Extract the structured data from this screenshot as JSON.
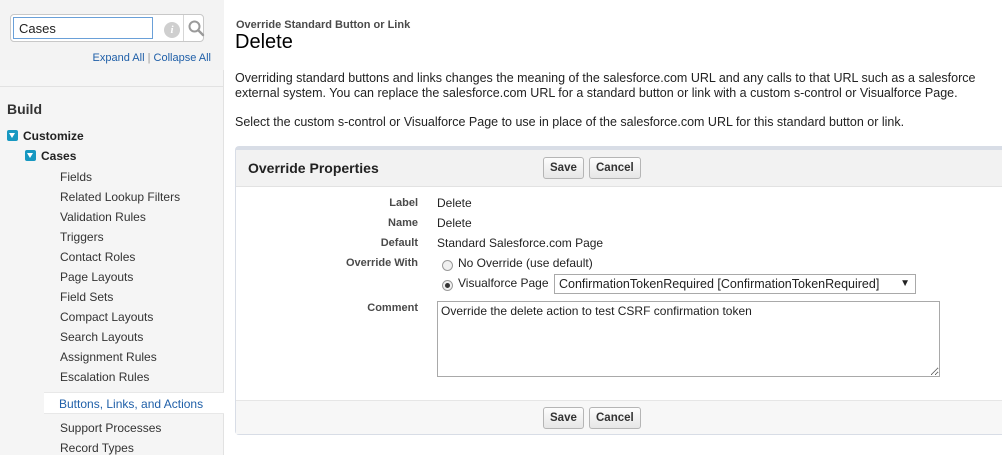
{
  "sidebar": {
    "search": {
      "value": "Cases",
      "info_icon": "info-icon",
      "search_icon": "magnifier-icon"
    },
    "expand_all": "Expand All",
    "separator": "|",
    "collapse_all": "Collapse All",
    "build_heading": "Build",
    "tree": {
      "customize": "Customize",
      "cases": "Cases",
      "items": [
        "Fields",
        "Related Lookup Filters",
        "Validation Rules",
        "Triggers",
        "Contact Roles",
        "Page Layouts",
        "Field Sets",
        "Compact Layouts",
        "Search Layouts",
        "Assignment Rules",
        "Escalation Rules"
      ],
      "active_item": "Buttons, Links, and Actions",
      "after_items": [
        "Support Processes",
        "Record Types"
      ]
    }
  },
  "main": {
    "breadcrumb": "Override Standard Button or Link",
    "title": "Delete",
    "description_line1": "Overriding standard buttons and links changes the meaning of the salesforce.com URL and any calls to that URL such as a salesforce",
    "description_line2": "external system. You can replace the salesforce.com URL for a standard button or link with a custom s-control or Visualforce Page.",
    "description_line3": "Select the custom s-control or Visualforce Page to use in place of the salesforce.com URL for this standard button or link.",
    "panel": {
      "title": "Override Properties",
      "save_label": "Save",
      "cancel_label": "Cancel",
      "fields": {
        "label_label": "Label",
        "label_value": "Delete",
        "name_label": "Name",
        "name_value": "Delete",
        "default_label": "Default",
        "default_value": "Standard Salesforce.com Page",
        "override_label": "Override With",
        "option_none": "No Override (use default)",
        "option_vf": "Visualforce Page",
        "selected_option": "option_vf",
        "vf_selected": "ConfirmationTokenRequired [ConfirmationTokenRequired]",
        "comment_label": "Comment",
        "comment_value": "Override the delete action to test CSRF confirmation token"
      }
    }
  }
}
